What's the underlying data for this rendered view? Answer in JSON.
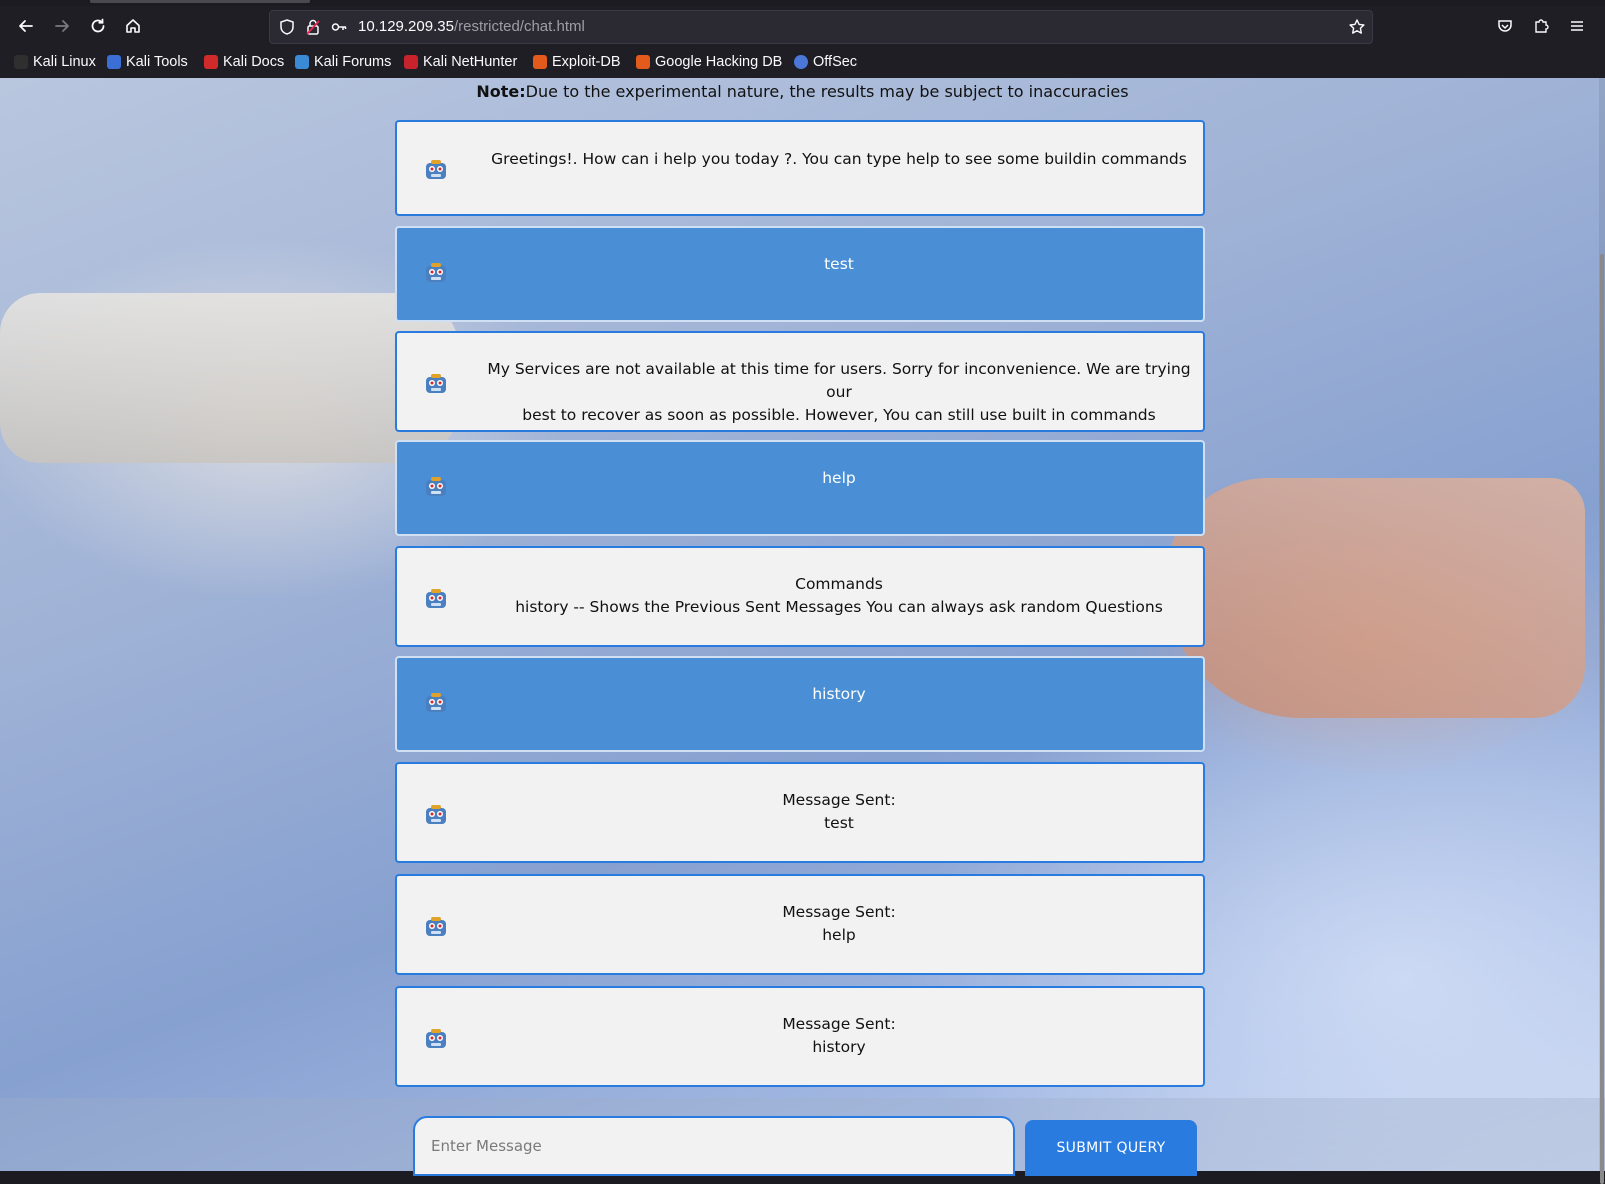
{
  "browser": {
    "url_host": "10.129.209.35",
    "url_path": "/restricted/chat.html",
    "bookmarks": [
      {
        "label": "Kali Linux",
        "color": "#2f2f2f"
      },
      {
        "label": "Kali Tools",
        "color": "#3b6fd6"
      },
      {
        "label": "Kali Docs",
        "color": "#d12a2a"
      },
      {
        "label": "Kali Forums",
        "color": "#3a8ad6"
      },
      {
        "label": "Kali NetHunter",
        "color": "#c8232c"
      },
      {
        "label": "Exploit-DB",
        "color": "#e25b1c"
      },
      {
        "label": "Google Hacking DB",
        "color": "#e25b1c"
      },
      {
        "label": "OffSec",
        "color": "#4a77d8"
      }
    ]
  },
  "page": {
    "note_label": "Note:",
    "note_text": "Due to the experimental nature, the results may be subject to inaccuracies"
  },
  "messages": [
    {
      "role": "bot",
      "lines": [
        "Greetings!. How can i help you today ?. You can type help to see some buildin commands"
      ]
    },
    {
      "role": "user",
      "lines": [
        "test"
      ]
    },
    {
      "role": "bot",
      "lines": [
        "My Services are not available at this time for users. Sorry for inconvenience. We are trying our",
        "best to recover as soon as possible. However, You can still use built in commands"
      ]
    },
    {
      "role": "user",
      "lines": [
        "help"
      ]
    },
    {
      "role": "bot",
      "lines": [
        "Commands",
        "history -- Shows the Previous Sent Messages You can always ask random Questions"
      ]
    },
    {
      "role": "user",
      "lines": [
        "history"
      ]
    },
    {
      "role": "bot",
      "lines": [
        "Message Sent:",
        "test"
      ]
    },
    {
      "role": "bot",
      "lines": [
        "Message Sent:",
        "help"
      ]
    },
    {
      "role": "bot",
      "lines": [
        "Message Sent:",
        "history"
      ]
    }
  ],
  "composer": {
    "placeholder": "Enter Message",
    "submit_label": "SUBMIT QUERY"
  },
  "colors": {
    "accent": "#2a7be0",
    "user_bubble": "#4a8fd6",
    "bot_bubble": "#f2f2f2"
  }
}
